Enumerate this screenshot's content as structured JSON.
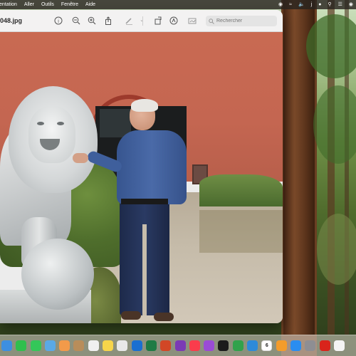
{
  "menubar": {
    "items": [
      "entation",
      "Aller",
      "Outils",
      "Fenêtre",
      "Aide"
    ],
    "status_icons": [
      "vpn-icon",
      "wifi-icon",
      "volume-icon",
      "bluetooth-icon",
      "lang-icon",
      "search-icon",
      "control-center-icon",
      "siri-icon"
    ]
  },
  "window": {
    "doc_title": "048.jpg",
    "search_placeholder": "Rechercher",
    "toolbar_icons": [
      "info-icon",
      "zoom-out-icon",
      "zoom-in-icon",
      "share-icon",
      "markup-pen-icon",
      "chevron-down-icon",
      "rotate-icon",
      "markup-circle-icon",
      "sign-icon"
    ]
  },
  "dock": {
    "calendar_day": "6",
    "apps": [
      {
        "name": "finder",
        "color": "#3d8fe0"
      },
      {
        "name": "facetime",
        "color": "#2fbf4d"
      },
      {
        "name": "messages",
        "color": "#34c759"
      },
      {
        "name": "maps",
        "color": "#5aa9e6"
      },
      {
        "name": "photos",
        "color": "#f29a4a"
      },
      {
        "name": "contacts",
        "color": "#b88d5a"
      },
      {
        "name": "reminders",
        "color": "#f0f0f0"
      },
      {
        "name": "notes",
        "color": "#f7d54a"
      },
      {
        "name": "preview",
        "color": "#e8e8e8"
      },
      {
        "name": "outlook",
        "color": "#1a6fd1"
      },
      {
        "name": "excel",
        "color": "#1f7b45"
      },
      {
        "name": "powerpoint",
        "color": "#d24726"
      },
      {
        "name": "onenote",
        "color": "#7b3ab5"
      },
      {
        "name": "music",
        "color": "#fa3c4c"
      },
      {
        "name": "podcasts",
        "color": "#9a4bd6"
      },
      {
        "name": "tv",
        "color": "#1b1b1b"
      },
      {
        "name": "numbers",
        "color": "#31a24c"
      },
      {
        "name": "keynote",
        "color": "#2d8ad9"
      },
      {
        "name": "calendar",
        "color": "#ffffff"
      },
      {
        "name": "pages",
        "color": "#f39c2b"
      },
      {
        "name": "app-store",
        "color": "#2a8df0"
      },
      {
        "name": "system-settings",
        "color": "#8e8e93"
      },
      {
        "name": "acrobat",
        "color": "#d9241b"
      },
      {
        "name": "textedit",
        "color": "#f4f4f4"
      }
    ]
  }
}
